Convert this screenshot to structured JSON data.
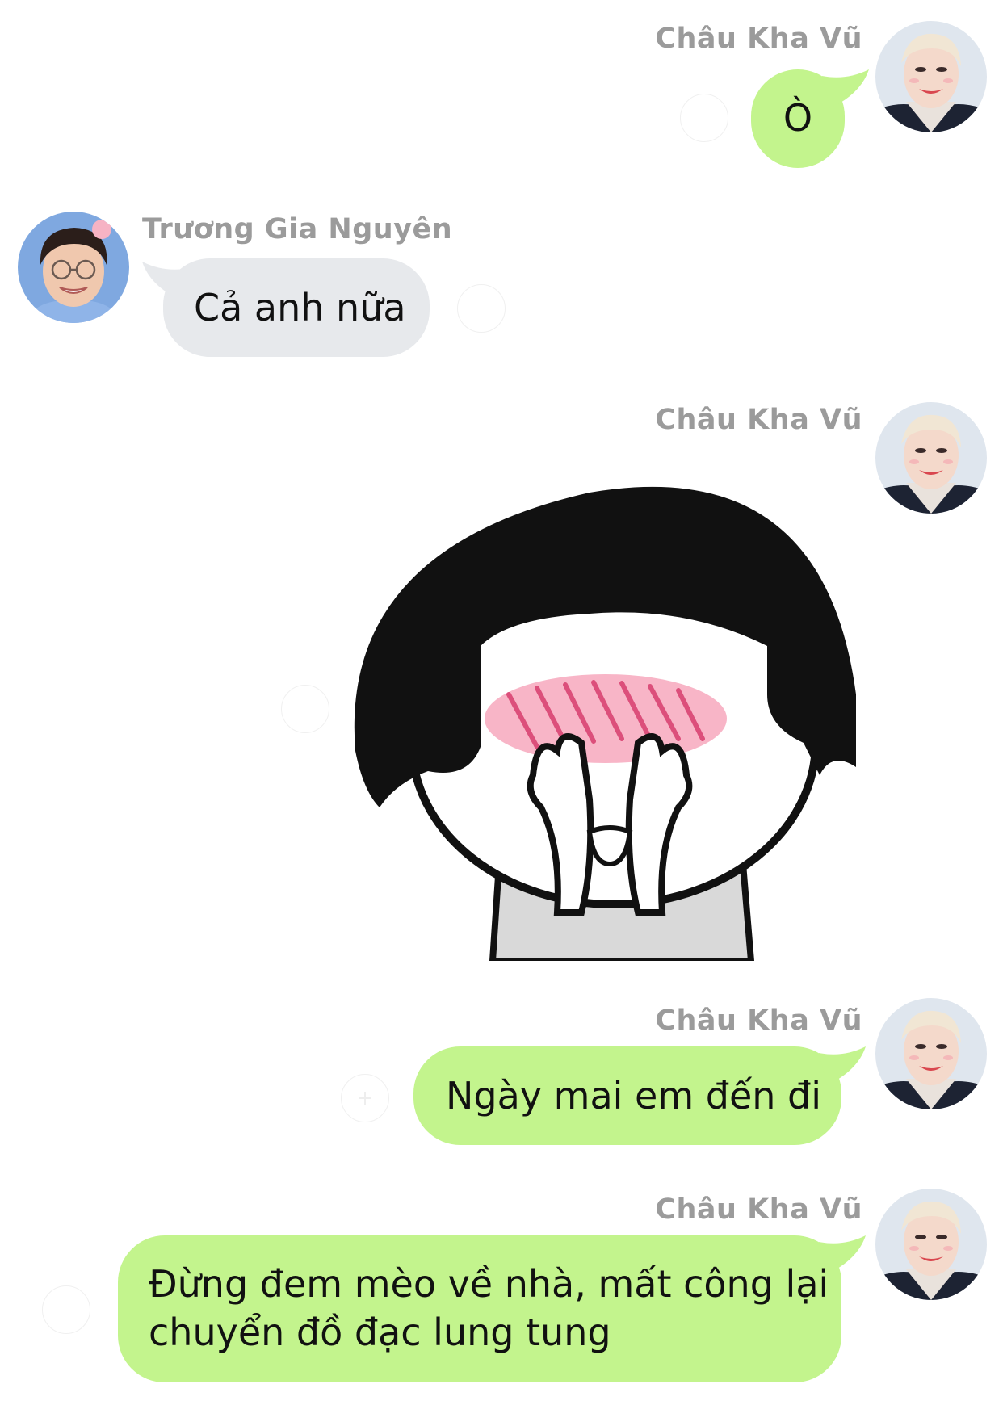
{
  "messages": [
    {
      "id": "m1",
      "side": "right",
      "sender": "Châu Kha Vũ",
      "text": "Ò",
      "bubble_color": "#c3f48d"
    },
    {
      "id": "m2",
      "side": "left",
      "sender": "Trương Gia Nguyên",
      "text": "Cả anh nữa",
      "bubble_color": "#e7e9ec"
    },
    {
      "id": "m3",
      "side": "right",
      "sender": "Châu Kha Vũ",
      "type": "sticker",
      "sticker": "blushing-cover-face-sticker"
    },
    {
      "id": "m4",
      "side": "right",
      "sender": "Châu Kha Vũ",
      "text": "Ngày mai em đến đi",
      "bubble_color": "#c3f48d"
    },
    {
      "id": "m5",
      "side": "right",
      "sender": "Châu Kha Vũ",
      "text_line1": "Đừng đem mèo về nhà, mất công lại",
      "text_line2": "chuyển đồ đạc lung tung",
      "bubble_color": "#c3f48d"
    }
  ],
  "colors": {
    "outgoing_bubble": "#c3f48d",
    "incoming_bubble": "#e7e9ec",
    "sender_name": "#9b9b9b"
  }
}
